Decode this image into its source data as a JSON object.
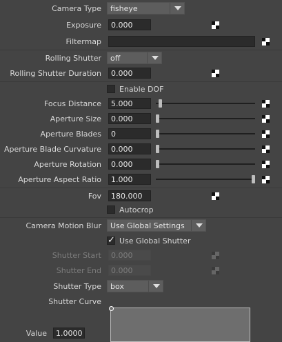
{
  "camera_type": {
    "label": "Camera Type",
    "value": "fisheye"
  },
  "exposure": {
    "label": "Exposure",
    "value": "0.000"
  },
  "filtermap": {
    "label": "Filtermap",
    "value": ""
  },
  "rolling_shutter": {
    "label": "Rolling Shutter",
    "value": "off"
  },
  "rolling_shutter_duration": {
    "label": "Rolling Shutter Duration",
    "value": "0.000"
  },
  "enable_dof": {
    "label": "Enable DOF",
    "checked": false
  },
  "focus_distance": {
    "label": "Focus Distance",
    "value": "5.000",
    "slider": 0.03
  },
  "aperture_size": {
    "label": "Aperture Size",
    "value": "0.000",
    "slider": 0.0
  },
  "aperture_blades": {
    "label": "Aperture Blades",
    "value": "0",
    "slider": 0.0
  },
  "aperture_blade_curvature": {
    "label": "Aperture Blade Curvature",
    "value": "0.000",
    "slider": 0.0
  },
  "aperture_rotation": {
    "label": "Aperture Rotation",
    "value": "0.000",
    "slider": 0.0
  },
  "aperture_aspect_ratio": {
    "label": "Aperture Aspect Ratio",
    "value": "1.000",
    "slider": 1.0
  },
  "fov": {
    "label": "Fov",
    "value": "180.000"
  },
  "autocrop": {
    "label": "Autocrop",
    "checked": false
  },
  "camera_motion_blur": {
    "label": "Camera Motion Blur",
    "value": "Use Global Settings"
  },
  "use_global_shutter": {
    "label": "Use Global Shutter",
    "checked": true
  },
  "shutter_start": {
    "label": "Shutter Start",
    "value": "0.000",
    "enabled": false
  },
  "shutter_end": {
    "label": "Shutter End",
    "value": "0.000",
    "enabled": false
  },
  "shutter_type": {
    "label": "Shutter Type",
    "value": "box"
  },
  "shutter_curve": {
    "label": "Shutter Curve"
  },
  "curve_value": {
    "label": "Value",
    "value": "1.0000"
  }
}
